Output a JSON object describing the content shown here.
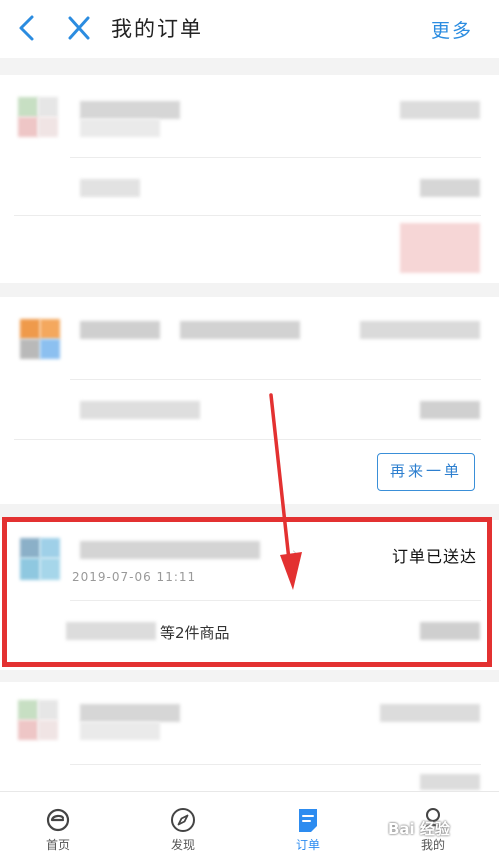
{
  "header": {
    "title": "我的订单",
    "more_label": "更多",
    "back_icon": "chevron-left-icon",
    "close_icon": "close-icon",
    "accent_color": "#2b8ce0"
  },
  "orders": [
    {
      "status": "",
      "reorder_label": ""
    },
    {
      "reorder_label": "再来一单"
    },
    {
      "status": "订单已送达",
      "timestamp": "2019-07-06 11:11",
      "items_summary": "等2件商品"
    }
  ],
  "tabbar": {
    "tabs": [
      {
        "label": "首页",
        "icon": "home-e-icon",
        "active": false
      },
      {
        "label": "发现",
        "icon": "compass-icon",
        "active": false
      },
      {
        "label": "订单",
        "icon": "order-document-icon",
        "active": true
      },
      {
        "label": "我的",
        "icon": "user-icon",
        "active": false
      }
    ],
    "active_color": "#2d8cf0"
  },
  "annotation": {
    "highlight_color": "#e33131",
    "watermark": "Bai 经验"
  }
}
